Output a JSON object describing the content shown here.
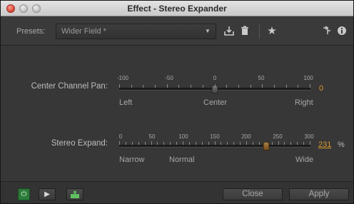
{
  "window": {
    "title": "Effect - Stereo Expander"
  },
  "presets": {
    "label": "Presets:",
    "value": "Wider Field *",
    "icons": [
      "save-preset-icon",
      "delete-preset-icon",
      "favorite-star-icon",
      "routing-icon",
      "info-icon"
    ]
  },
  "center_pan": {
    "label": "Center Channel Pan:",
    "ticks": [
      "-100",
      "-50",
      "0",
      "50",
      "100"
    ],
    "left": "Left",
    "center": "Center",
    "right": "Right",
    "value": "0",
    "min": -100,
    "max": 100
  },
  "stereo_expand": {
    "label": "Stereo Expand:",
    "ticks": [
      "0",
      "50",
      "100",
      "150",
      "200",
      "250",
      "300"
    ],
    "narrow": "Narrow",
    "normal": "Normal",
    "wide": "Wide",
    "value": "231",
    "unit": "%",
    "min": 0,
    "max": 300
  },
  "footer": {
    "close_label": "Close",
    "apply_label": "Apply",
    "icons": [
      "power-icon",
      "play-icon",
      "export-icon"
    ]
  },
  "colors": {
    "accent_orange": "#d59a2b",
    "power_green": "#2d7b3a"
  }
}
